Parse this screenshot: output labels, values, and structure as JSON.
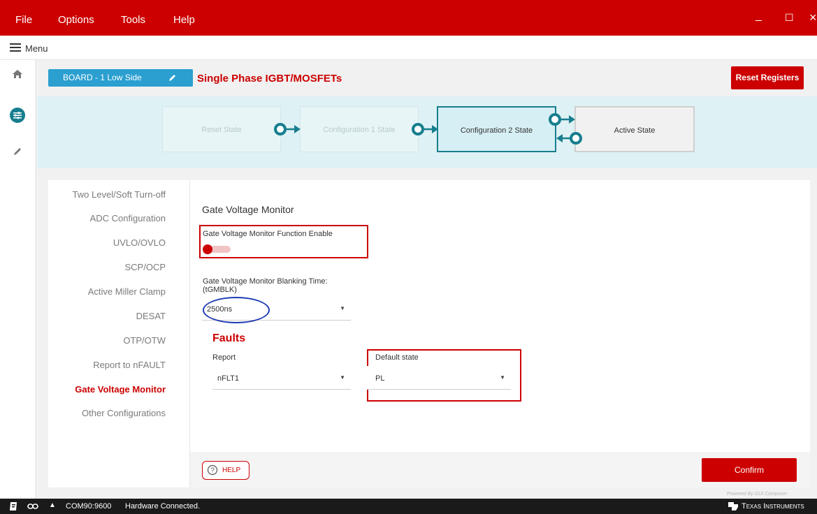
{
  "menubar": {
    "items": [
      "File",
      "Options",
      "Tools",
      "Help"
    ],
    "minimize": "_",
    "maximize": "☐",
    "close": "×"
  },
  "menurow": {
    "label": "Menu"
  },
  "board": {
    "name": "BOARD - 1 Low Side",
    "title": "Single Phase IGBT/MOSFETs",
    "reset_label": "Reset Registers"
  },
  "states": {
    "reset": "Reset State",
    "config1": "Configuration 1 State",
    "config2": "Configuration 2 State",
    "active": "Active State"
  },
  "nav": {
    "items": [
      "Two Level/Soft Turn-off",
      "ADC Configuration",
      "UVLO/OVLO",
      "SCP/OCP",
      "Active Miller Clamp",
      "DESAT",
      "OTP/OTW",
      "Report to nFAULT",
      "Gate Voltage Monitor",
      "Other Configurations"
    ],
    "active": "Gate Voltage Monitor"
  },
  "form": {
    "heading": "Gate Voltage Monitor",
    "enable_label": "Gate Voltage Monitor Function Enable",
    "enable_value": false,
    "blanking_label_1": "Gate Voltage Monitor Blanking Time:",
    "blanking_label_2": "(tGMBLK)",
    "blanking_value": "2500ns",
    "faults_heading": "Faults",
    "report_label": "Report",
    "report_value": "nFLT1",
    "default_label": "Default state",
    "default_value": "PL"
  },
  "footer": {
    "help_label": "HELP",
    "confirm_label": "Confirm",
    "powered": "Powered By GUI Composer"
  },
  "status": {
    "port": "COM90:9600",
    "message": "Hardware Connected.",
    "brand": "Texas Instruments"
  },
  "colors": {
    "accent_red": "#cc0000",
    "board_blue": "#2a9fd0",
    "teal": "#177e8e",
    "state_band": "#def1f4"
  }
}
